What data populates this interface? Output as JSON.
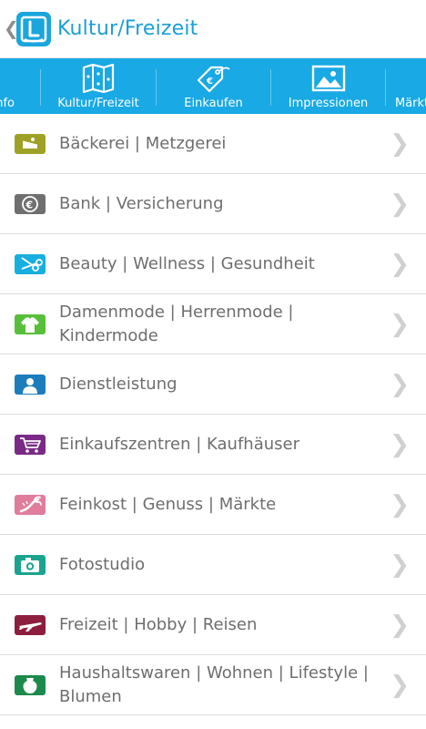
{
  "header": {
    "title": "Kultur/Freizeit",
    "up_icon": "chevron-left-icon",
    "logo_icon": "app-logo-l-icon"
  },
  "tabs": [
    {
      "label": "Info",
      "icon": "info-icon"
    },
    {
      "label": "Kultur/Freizeit",
      "icon": "map-icon"
    },
    {
      "label": "Einkaufen",
      "icon": "price-tag-icon"
    },
    {
      "label": "Impressionen",
      "icon": "picture-icon"
    },
    {
      "label": "Märkte",
      "icon": "market-icon"
    }
  ],
  "categories": [
    {
      "label": "Bäckerei | Metzgerei",
      "icon": "cake-icon",
      "color": "#9ea125"
    },
    {
      "label": "Bank | Versicherung",
      "icon": "euro-icon",
      "color": "#6f6f6f"
    },
    {
      "label": "Beauty | Wellness | Gesundheit",
      "icon": "scissors-icon",
      "color": "#18aee0"
    },
    {
      "label": "Damenmode | Herrenmode | Kindermode",
      "icon": "shirt-icon",
      "color": "#58bf3a"
    },
    {
      "label": "Dienstleistung",
      "icon": "person-icon",
      "color": "#1b7dbb"
    },
    {
      "label": "Einkaufszentren | Kaufhäuser",
      "icon": "shopping-cart-icon",
      "color": "#7a2a86"
    },
    {
      "label": "Feinkost | Genuss | Märkte",
      "icon": "lobster-icon",
      "color": "#e07c9c"
    },
    {
      "label": "Fotostudio",
      "icon": "camera-icon",
      "color": "#1aa48f"
    },
    {
      "label": "Freizeit | Hobby | Reisen",
      "icon": "airplane-icon",
      "color": "#8e1e3e"
    },
    {
      "label": "Haushaltswaren | Wohnen | Lifestyle | Blumen",
      "icon": "vase-icon",
      "color": "#1b8a4a"
    }
  ],
  "colors": {
    "accent": "#19a9e4",
    "title": "#1a9fd8",
    "text": "#6e6e6e",
    "divider": "#dcdcdc"
  }
}
